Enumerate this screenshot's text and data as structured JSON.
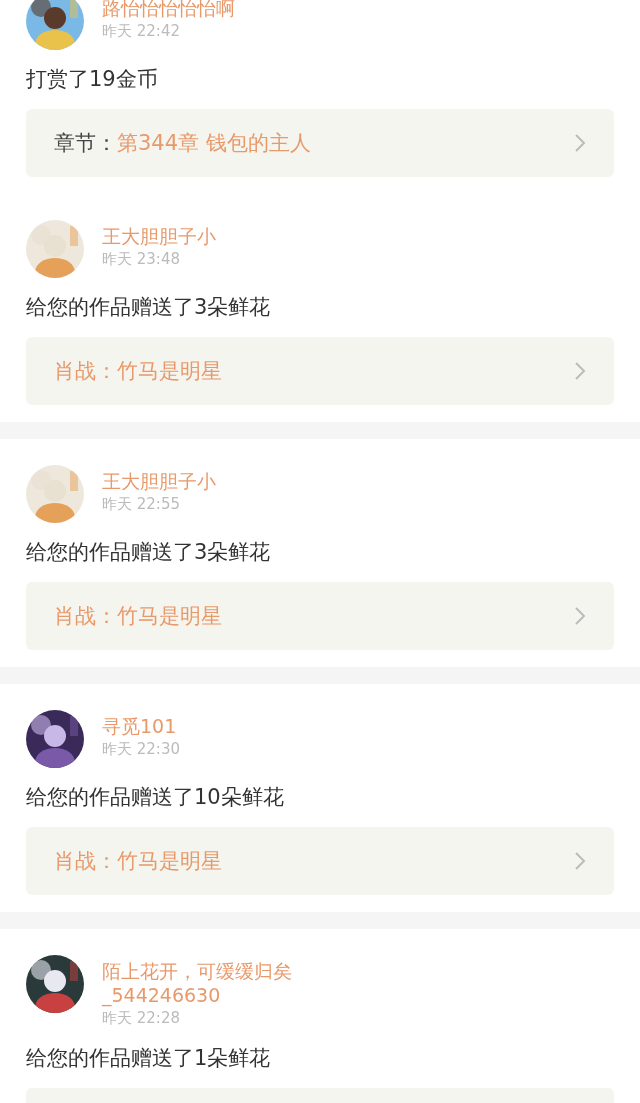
{
  "groups": [
    {
      "entries": [
        {
          "name": "路怡怡怡怡怡啊",
          "time": "昨天 22:42",
          "message": "打赏了19金币",
          "card": {
            "kind": "link",
            "prefix": "章节：",
            "title": "第344章 钱包的主人"
          }
        },
        {
          "name": "王大胆胆子小",
          "time": "昨天 23:48",
          "message": "给您的作品赠送了3朵鲜花",
          "card": {
            "kind": "link",
            "title": "肖战：竹马是明星"
          }
        }
      ]
    },
    {
      "entries": [
        {
          "name": "王大胆胆子小",
          "time": "昨天 22:55",
          "message": "给您的作品赠送了3朵鲜花",
          "card": {
            "kind": "link",
            "title": "肖战：竹马是明星"
          }
        }
      ]
    },
    {
      "entries": [
        {
          "name": "寻觅101",
          "time": "昨天 22:30",
          "message": "给您的作品赠送了10朵鲜花",
          "card": {
            "kind": "link",
            "title": "肖战：竹马是明星"
          }
        }
      ]
    },
    {
      "entries": [
        {
          "name": "陌上花开，可缓缓归矣_544246630",
          "time": "昨天 22:28",
          "message": "给您的作品赠送了1朵鲜花",
          "card": {
            "kind": "cut"
          }
        }
      ]
    }
  ]
}
